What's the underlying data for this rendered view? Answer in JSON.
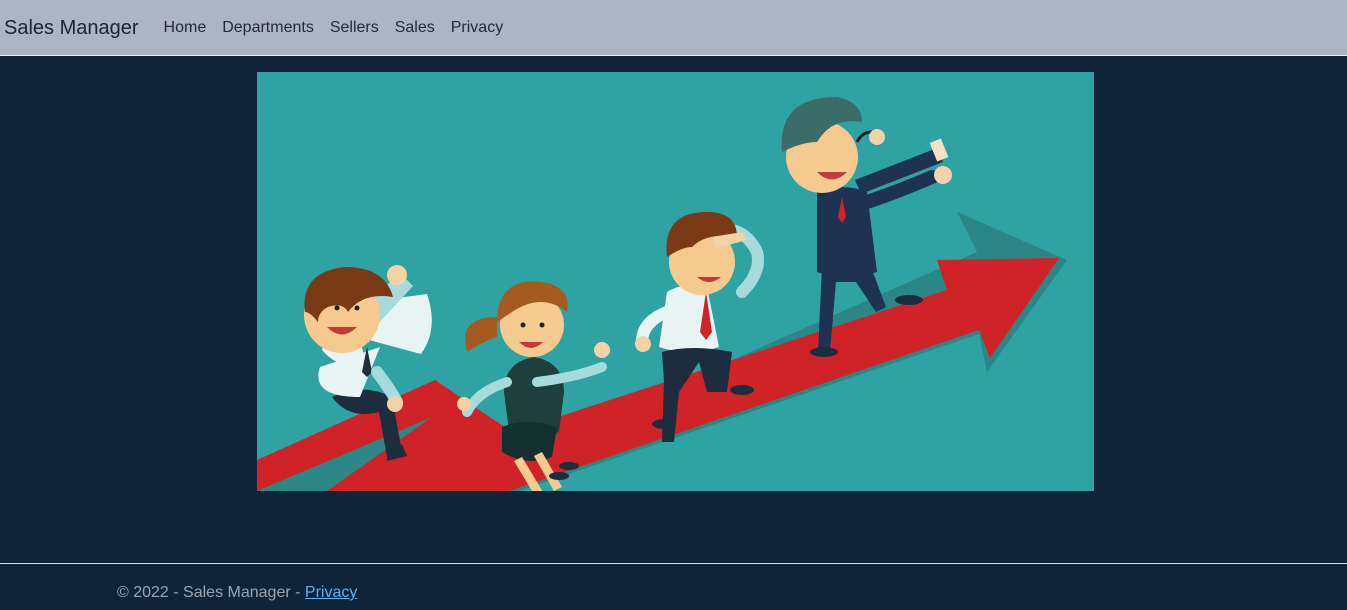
{
  "navbar": {
    "brand": "Sales Manager",
    "links": [
      "Home",
      "Departments",
      "Sellers",
      "Sales",
      "Privacy"
    ]
  },
  "footer": {
    "text": "© 2022 - Sales Manager - ",
    "privacy_link": "Privacy"
  },
  "colors": {
    "navbar_bg": "#abb6c2",
    "page_bg": "#0f2439",
    "hero_bg": "#2fa3a3",
    "arrow": "#cf2327",
    "link": "#5fb0f0"
  }
}
